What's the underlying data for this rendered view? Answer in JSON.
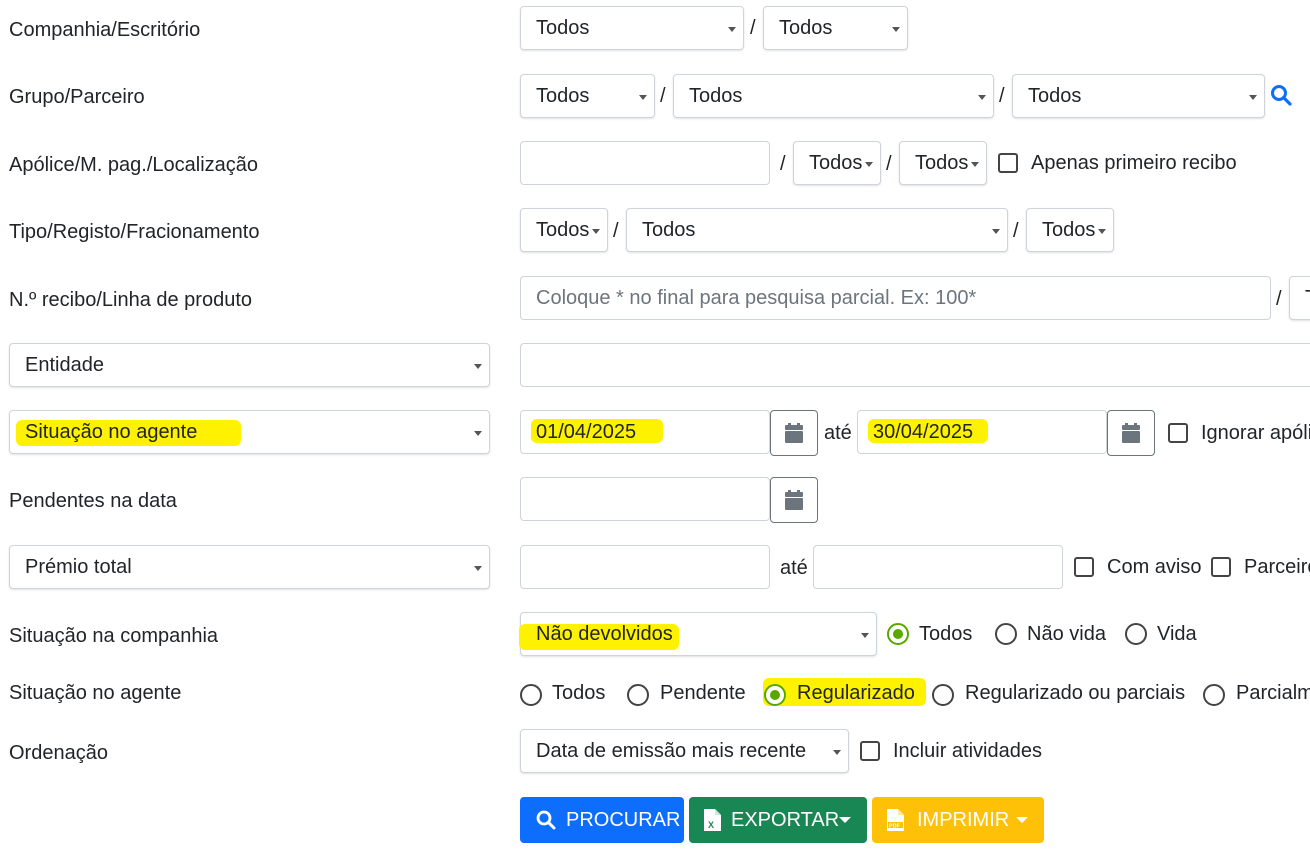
{
  "rows": {
    "companhia": {
      "label": "Companhia/Escritório",
      "sel1": "Todos",
      "sel2": "Todos"
    },
    "grupo": {
      "label": "Grupo/Parceiro",
      "sel1": "Todos",
      "sel2": "Todos",
      "sel3": "Todos",
      "icon": "search-icon"
    },
    "apolice": {
      "label": "Apólice/M. pag./Localização",
      "input_value": "",
      "sel1": "Todos",
      "sel2": "Todos",
      "checkbox_label": "Apenas primeiro recibo",
      "checked": false
    },
    "tipo": {
      "label": "Tipo/Registo/Fracionamento",
      "sel1": "Todos",
      "sel2": "Todos",
      "sel3": "Todos"
    },
    "recibo": {
      "label": "N.º recibo/Linha de produto",
      "placeholder": "Coloque * no final para pesquisa parcial. Ex: 100*",
      "sel_partial": "T"
    },
    "entidade": {
      "select": "Entidade",
      "input_value": ""
    },
    "situacao_agente_date": {
      "select": "Situação no agente",
      "date_from": "01/04/2025",
      "ate": "até",
      "date_to": "30/04/2025",
      "checkbox_label": "Ignorar apóli",
      "checked": false
    },
    "pendentes": {
      "label": "Pendentes na data",
      "date": ""
    },
    "premio": {
      "select": "Prémio total",
      "from": "",
      "ate": "até",
      "to": "",
      "chk1_label": "Com aviso",
      "chk2_label": "Parceiro"
    },
    "situacao_companhia": {
      "label": "Situação na companhia",
      "select": "Não devolvidos",
      "radios": [
        "Todos",
        "Não vida",
        "Vida"
      ],
      "selected": "Todos"
    },
    "situacao_agente": {
      "label": "Situação no agente",
      "radios": [
        "Todos",
        "Pendente",
        "Regularizado",
        "Regularizado ou parciais",
        "Parcialm"
      ],
      "selected": "Regularizado"
    },
    "ordenacao": {
      "label": "Ordenação",
      "select": "Data de emissão mais recente",
      "checkbox_label": "Incluir atividades",
      "checked": false
    }
  },
  "buttons": {
    "procurar": "PROCURAR",
    "exportar": "EXPORTAR",
    "imprimir": "IMPRIMIR"
  },
  "colors": {
    "primary": "#0d6efd",
    "success": "#198754",
    "warning": "#ffc107",
    "radio_checked": "#5aa700",
    "highlight": "#fff200"
  },
  "separator": "/"
}
